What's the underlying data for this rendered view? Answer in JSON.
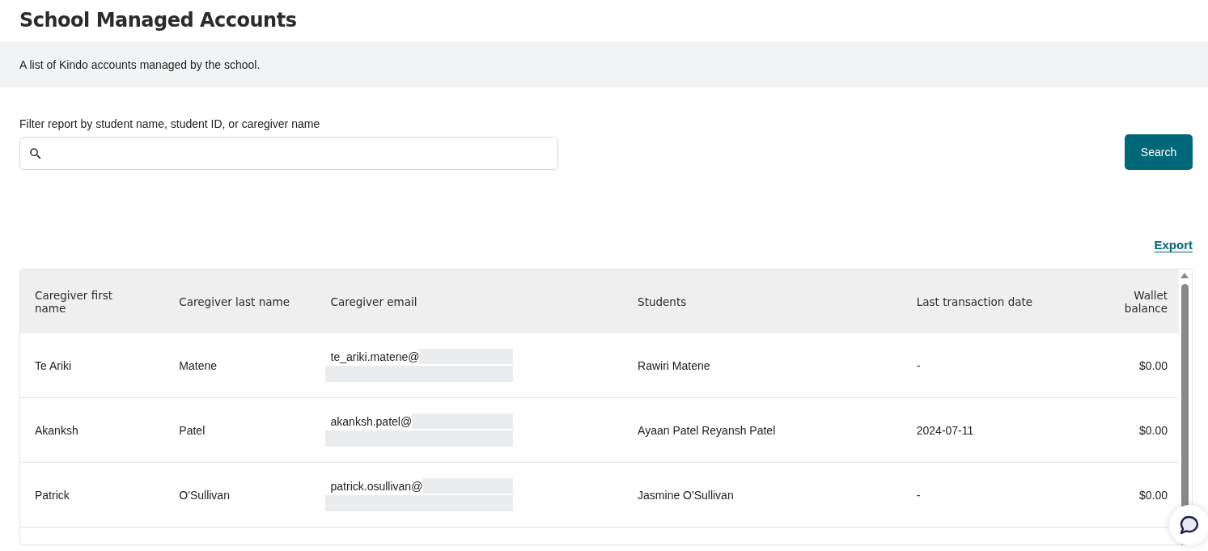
{
  "page": {
    "title": "School Managed Accounts",
    "description": "A list of Kindo accounts managed by the school."
  },
  "filter": {
    "label": "Filter report by student name, student ID, or caregiver name",
    "button": "Search"
  },
  "export_link": "Export",
  "table": {
    "columns": [
      "Caregiver first name",
      "Caregiver last name",
      "Caregiver email",
      "Students",
      "Last transaction date",
      "Wallet balance"
    ],
    "rows": [
      {
        "first_name": "Te Ariki",
        "last_name": "Matene",
        "email": "te_ariki.matene@",
        "students": "Rawiri Matene",
        "last_transaction": "-",
        "balance": "$0.00"
      },
      {
        "first_name": "Akanksh",
        "last_name": "Patel",
        "email": "akanksh.patel@",
        "students": "Ayaan Patel Reyansh Patel",
        "last_transaction": "2024-07-11",
        "balance": "$0.00"
      },
      {
        "first_name": "Patrick",
        "last_name": "O'Sullivan",
        "email": "patrick.osullivan@",
        "students": "Jasmine O'Sullivan",
        "last_transaction": "-",
        "balance": "$0.00"
      }
    ]
  }
}
